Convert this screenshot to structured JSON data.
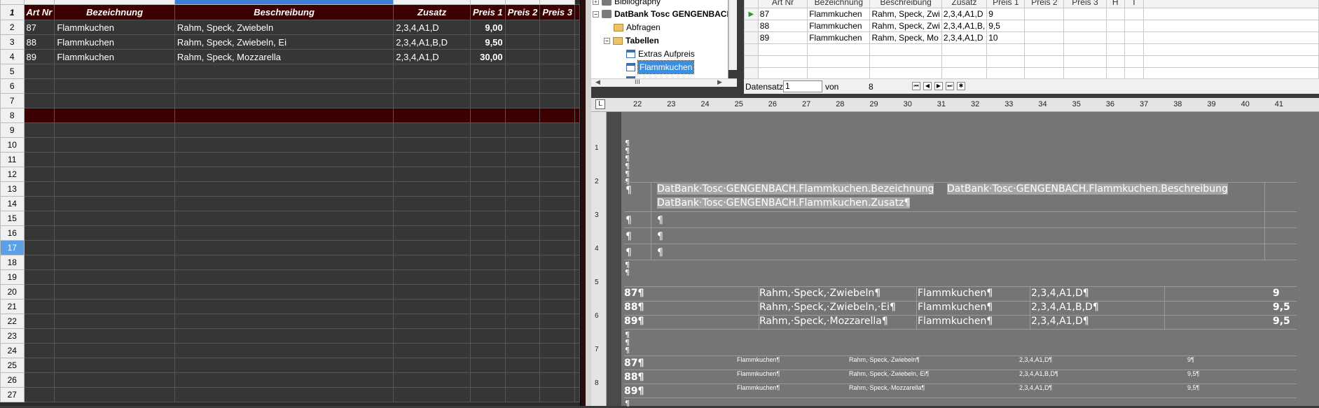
{
  "sheet": {
    "headers": [
      "Art Nr",
      "Bezeichnung",
      "Beschreibung",
      "Zusatz",
      "Preis 1",
      "Preis 2",
      "Preis 3"
    ],
    "row_numbers": [
      "1",
      "2",
      "3",
      "4",
      "5",
      "6",
      "7",
      "8",
      "9",
      "10",
      "11",
      "12",
      "13",
      "14",
      "15",
      "16",
      "17",
      "18",
      "19",
      "20",
      "21",
      "22",
      "23",
      "24",
      "25",
      "26",
      "27"
    ],
    "rows": [
      [
        "87",
        "Flammkuchen",
        "Rahm, Speck, Zwiebeln",
        "2,3,4,A1,D",
        "9,00"
      ],
      [
        "88",
        "Flammkuchen",
        "Rahm, Speck, Zwiebeln, Ei",
        "2,3,4,A1,B,D",
        "9,50"
      ],
      [
        "89",
        "Flammkuchen",
        "Rahm, Speck, Mozzarella",
        "2,3,4,A1,D",
        "30,00"
      ]
    ]
  },
  "tree": {
    "bibliography": "Bibliography",
    "database": "DatBank Tosc GENGENBACH",
    "queries": "Abfragen",
    "tables": "Tabellen",
    "table1": "Extras Aufpreis",
    "table2": "Flammkuchen",
    "scroll_mark": "III"
  },
  "grid": {
    "headers": [
      "Art Nr",
      "Bezeichnung",
      "Beschreibung",
      "Zusatz",
      "Preis 1",
      "Preis 2",
      "Preis 3",
      "H",
      "I"
    ],
    "rows": [
      [
        "87",
        "Flammkuchen",
        "Rahm, Speck, Zwi",
        "2,3,4,A1,D",
        "9"
      ],
      [
        "88",
        "Flammkuchen",
        "Rahm, Speck, Zwi",
        "2,3,4,A1,B,",
        "9,5"
      ],
      [
        "89",
        "Flammkuchen",
        "Rahm, Speck, Mo",
        "2,3,4,A1,D",
        "10"
      ]
    ],
    "nav_label": "Datensatz",
    "record": "1",
    "of_label": "von",
    "total": "8"
  },
  "ruler": {
    "h_ticks": [
      "22",
      "23",
      "24",
      "25",
      "26",
      "27",
      "28",
      "29",
      "30",
      "31",
      "32",
      "33",
      "34",
      "35",
      "36",
      "37",
      "38",
      "39",
      "40",
      "41"
    ],
    "v_ticks": [
      "1",
      "2",
      "3",
      "4",
      "5",
      "6",
      "7",
      "8"
    ]
  },
  "doc": {
    "pilcrow": "¶",
    "field_bez": "DatBank·Tosc·GENGENBACH.Flammkuchen.Bezeichnung",
    "field_besch": "DatBank·Tosc·GENGENBACH.Flammkuchen.Beschreibung",
    "field_zus": "DatBank·Tosc·GENGENBACH.Flammkuchen.Zusatz¶",
    "big_rows": [
      {
        "nr": "87¶",
        "desc": "Rahm,·Speck,·Zwiebeln¶",
        "name": "Flammkuchen¶",
        "zus": "2,3,4,A1,D¶",
        "price": "9"
      },
      {
        "nr": "88¶",
        "desc": "Rahm,·Speck,·Zwiebeln,·Ei¶",
        "name": "Flammkuchen¶",
        "zus": "2,3,4,A1,B,D¶",
        "price": "9,5"
      },
      {
        "nr": "89¶",
        "desc": "Rahm,·Speck,·Mozzarella¶",
        "name": "Flammkuchen¶",
        "zus": "2,3,4,A1,D¶",
        "price": "9,5"
      }
    ],
    "small_rows": [
      {
        "nr": "87¶",
        "name": "Flammkuchen¶",
        "desc": "Rahm,·Speck,·Zwiebeln¶",
        "zus": "2,3,4,A1,D¶",
        "price": "9¶"
      },
      {
        "nr": "88¶",
        "name": "Flammkuchen¶",
        "desc": "Rahm,·Speck,·Zwiebeln,·Ei¶",
        "zus": "2,3,4,A1,B,D¶",
        "price": "9,5¶"
      },
      {
        "nr": "89¶",
        "name": "Flammkuchen¶",
        "desc": "Rahm,·Speck,·Mozzarella¶",
        "zus": "2,3,4,A1,D¶",
        "price": "9,5¶"
      }
    ]
  }
}
